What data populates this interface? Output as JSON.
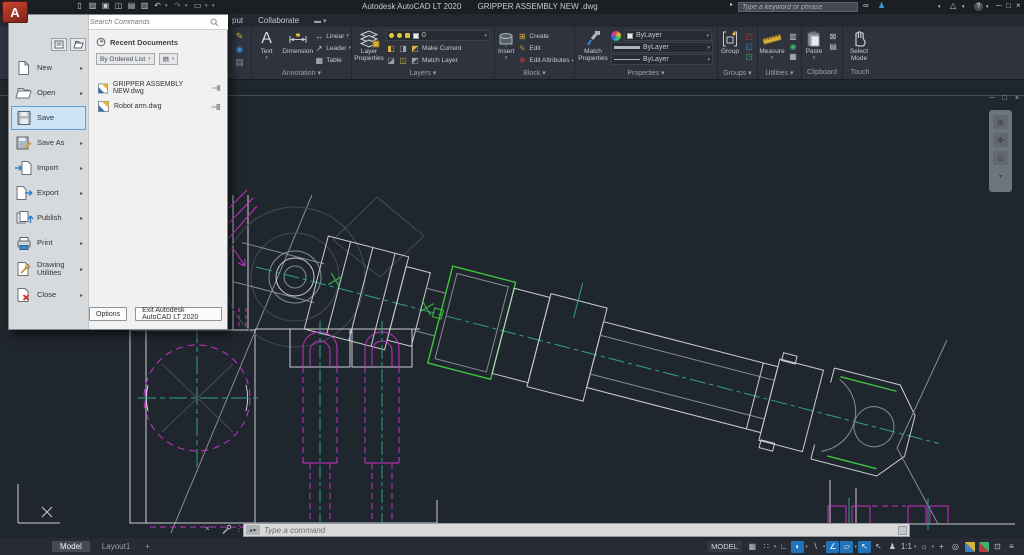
{
  "titlebar": {
    "app_title": "Autodesk AutoCAD LT 2020",
    "doc_title": "GRIPPER ASSEMBLY NEW .dwg",
    "search_placeholder": "Type a keyword or phrase"
  },
  "ribbon": {
    "tab_output": "put",
    "tab_collaborate": "Collaborate",
    "annotation": {
      "label": "Annotation ▾",
      "text": "Text",
      "dimension": "Dimension",
      "linear": "Linear",
      "leader": "Leader",
      "table": "Table"
    },
    "layers": {
      "label": "Layers ▾",
      "layer_properties": "Layer Properties",
      "current_layer": "0",
      "make_current": "Make Current",
      "match_layer": "Match Layer"
    },
    "block": {
      "label": "Block ▾",
      "insert": "Insert",
      "create": "Create",
      "edit": "Edit",
      "edit_attributes": "Edit Attributes"
    },
    "properties": {
      "label": "Properties ▾",
      "match_properties": "Match Properties",
      "color_value": "ByLayer",
      "lineweight_value": "ByLayer",
      "linetype_value": "ByLayer"
    },
    "groups": {
      "label": "Groups ▾",
      "group": "Group"
    },
    "utilities": {
      "label": "Utilities ▾",
      "measure": "Measure"
    },
    "clipboard": {
      "label": "Clipboard",
      "paste": "Paste"
    },
    "touch": {
      "label": "Touch",
      "select_mode": "Select Mode"
    }
  },
  "app_menu": {
    "search_placeholder": "Search Commands",
    "recent_header": "Recent Documents",
    "sort_label": "By Ordered List",
    "items": [
      {
        "label": "New"
      },
      {
        "label": "Open"
      },
      {
        "label": "Save"
      },
      {
        "label": "Save As"
      },
      {
        "label": "Import"
      },
      {
        "label": "Export"
      },
      {
        "label": "Publish"
      },
      {
        "label": "Print"
      },
      {
        "label": "Drawing Utilities"
      },
      {
        "label": "Close"
      }
    ],
    "recent_files": [
      {
        "name": "GRIPPER ASSEMBLY NEW.dwg"
      },
      {
        "name": "Robot arm.dwg"
      }
    ],
    "options_label": "Options",
    "exit_label": "Exit Autodesk AutoCAD LT 2020"
  },
  "command_line": {
    "placeholder": "Type a command"
  },
  "bottom": {
    "model_tab": "Model",
    "layout_tab": "Layout1",
    "add_tab": "+",
    "model_badge": "MODEL",
    "scale_label": "1:1"
  },
  "colors": {
    "canvas_bg": "#20262d",
    "visible_line": "#c9ced4",
    "hidden_line_magenta": "#c832c8",
    "centerline_teal": "#2fa28b",
    "selection_green": "#3cc43c",
    "accent_blue": "#2273b8"
  }
}
